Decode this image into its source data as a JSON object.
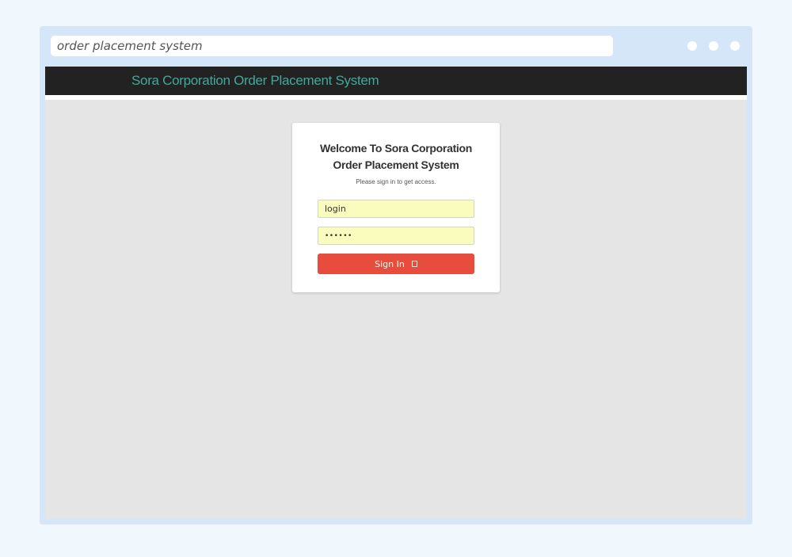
{
  "browser": {
    "address": "order placement system"
  },
  "navbar": {
    "brand": "Sora Corporation Order Placement System"
  },
  "login": {
    "title": "Welcome To Sora Corporation Order Placement System",
    "subtitle": "Please sign in to get access.",
    "username_value": "login",
    "password_value": "••••••",
    "signin_label": "Sign In",
    "signin_icon": "sign-in-icon"
  },
  "colors": {
    "navbar_bg": "#222222",
    "brand_text": "#40a99b",
    "button_bg": "#e74c3c",
    "input_bg": "#fafcbd",
    "page_bg": "#e5e5e5"
  }
}
